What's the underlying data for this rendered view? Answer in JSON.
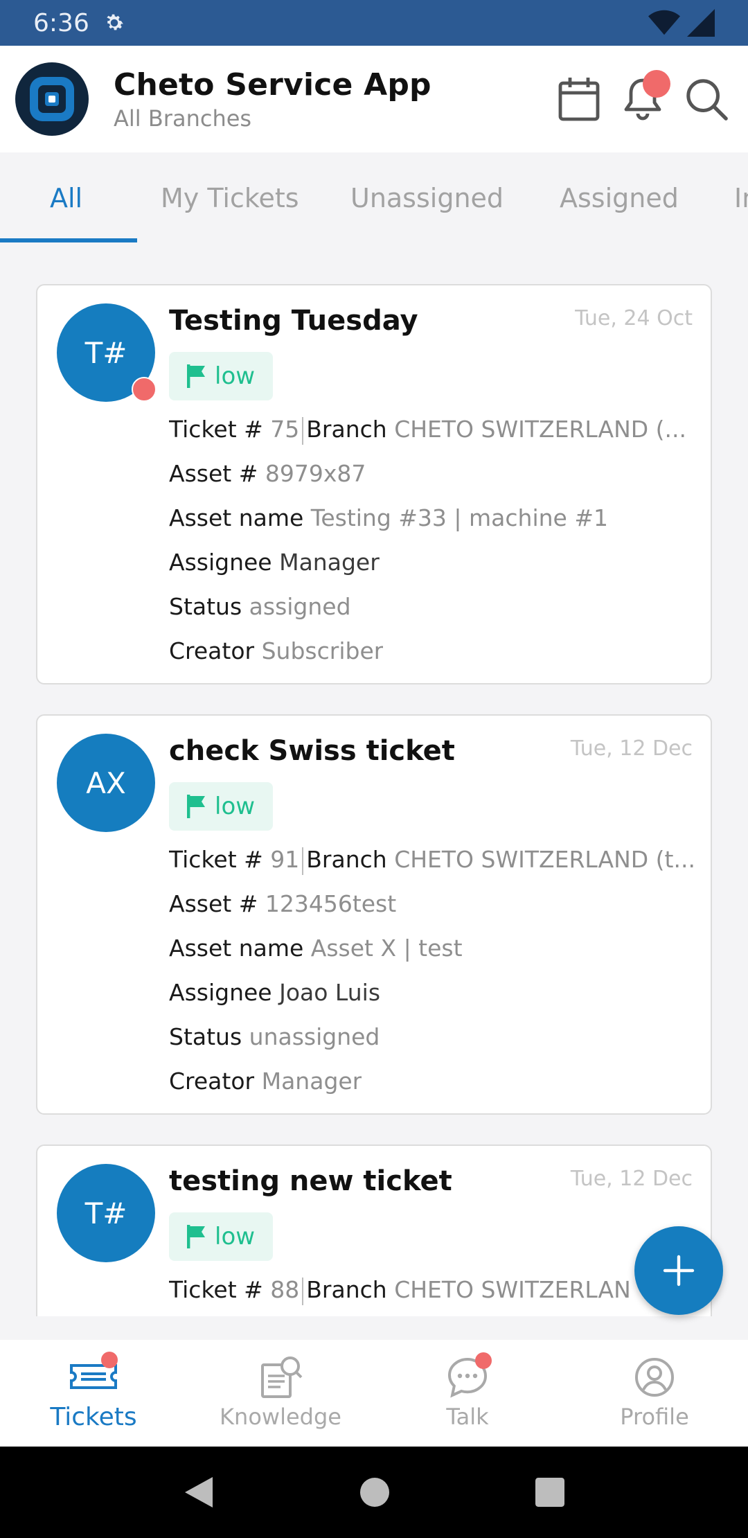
{
  "status_bar": {
    "time": "6:36"
  },
  "header": {
    "title": "Cheto Service App",
    "subtitle": "All Branches",
    "icons": [
      "calendar-icon",
      "bell-icon",
      "search-icon"
    ]
  },
  "tabs": [
    {
      "label": "All",
      "active": true
    },
    {
      "label": "My Tickets",
      "active": false
    },
    {
      "label": "Unassigned",
      "active": false
    },
    {
      "label": "Assigned",
      "active": false
    },
    {
      "label": "In",
      "active": false
    }
  ],
  "labels": {
    "ticket": "Ticket #",
    "branch": "Branch",
    "asset_no": "Asset #",
    "asset_name": "Asset name",
    "assignee": "Assignee",
    "status": "Status",
    "creator": "Creator"
  },
  "tickets": [
    {
      "initials": "T#",
      "title": "Testing Tuesday",
      "date": "Tue, 24 Oct",
      "priority": "low",
      "ticket_no": "75",
      "branch": "CHETO SWITZERLAND (...",
      "asset_no": "8979x87",
      "asset_name": "Testing #33 | machine #1",
      "assignee": "Manager",
      "status": "assigned",
      "creator": "Subscriber"
    },
    {
      "initials": "AX",
      "title": "check Swiss ticket",
      "date": "Tue, 12 Dec",
      "priority": "low",
      "ticket_no": "91",
      "branch": "CHETO SWITZERLAND (t...",
      "asset_no": "123456test",
      "asset_name": "Asset X | test",
      "assignee": "Joao Luis",
      "status": "unassigned",
      "creator": "Manager"
    },
    {
      "initials": "T#",
      "title": "testing new ticket",
      "date": "Tue, 12 Dec",
      "priority": "low",
      "ticket_no": "88",
      "branch": "CHETO SWITZERLAN"
    }
  ],
  "bottom_nav": [
    {
      "label": "Tickets",
      "icon": "ticket-icon",
      "active": true
    },
    {
      "label": "Knowledge",
      "icon": "knowledge-icon",
      "active": false
    },
    {
      "label": "Talk",
      "icon": "chat-icon",
      "active": false
    },
    {
      "label": "Profile",
      "icon": "profile-icon",
      "active": false
    }
  ],
  "colors": {
    "status_bar": "#2c5a93",
    "accent": "#157dbf",
    "priority_low": "#1fbf8f",
    "notification": "#f06a6a"
  }
}
